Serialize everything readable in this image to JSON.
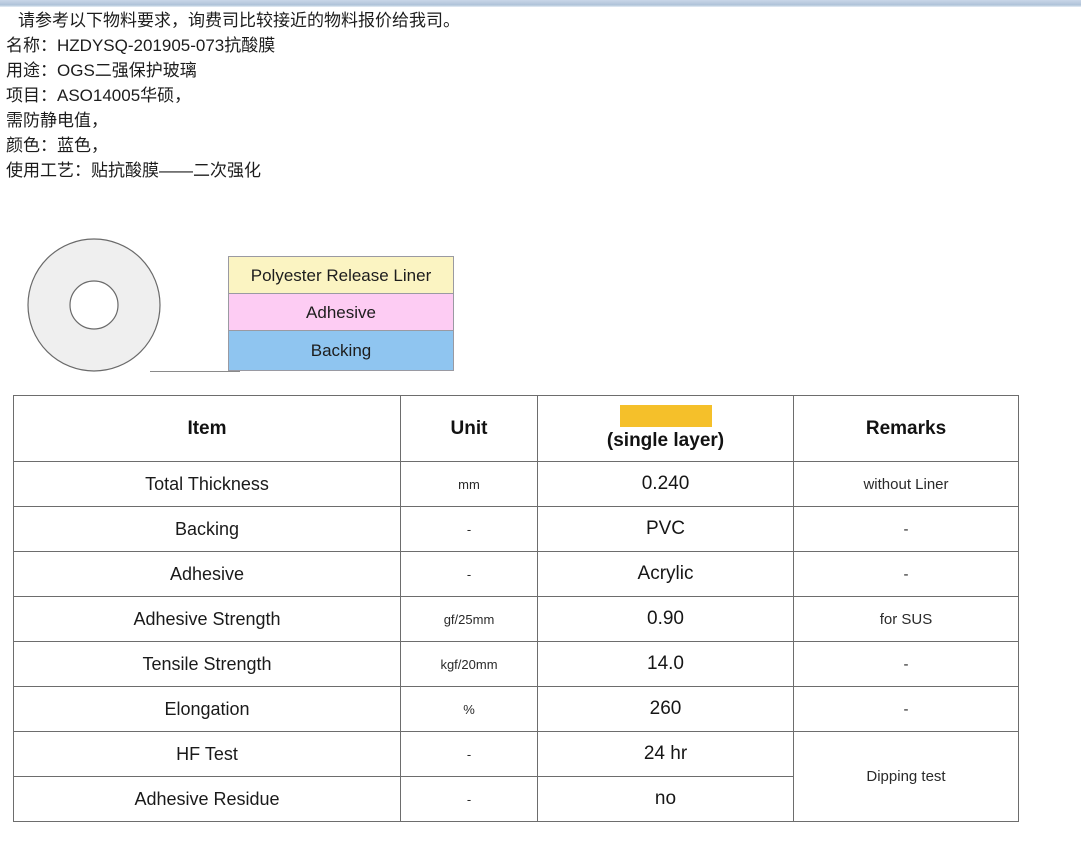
{
  "intro": {
    "lines": [
      {
        "text": "请参考以下物料要求，询费司比较接近的物料报价给我司。",
        "indent": true
      },
      {
        "text": "名称：HZDYSQ-201905-073抗酸膜",
        "indent": false
      },
      {
        "text": "用途：OGS二强保护玻璃",
        "indent": false
      },
      {
        "text": "项目：ASO14005华硕，",
        "indent": false
      },
      {
        "text": "需防静电值，",
        "indent": false
      },
      {
        "text": "颜色：蓝色，",
        "indent": false
      },
      {
        "text": "使用工艺：贴抗酸膜——二次强化",
        "indent": false
      }
    ]
  },
  "diagram": {
    "roll_label": "tape-roll",
    "layers": [
      {
        "name": "liner",
        "label": "Polyester Release Liner",
        "color": "#fbf4c2"
      },
      {
        "name": "adhesive",
        "label": "Adhesive",
        "color": "#fdccf3"
      },
      {
        "name": "backing",
        "label": "Backing",
        "color": "#8fc5f0"
      }
    ]
  },
  "table": {
    "headers": {
      "item": "Item",
      "unit": "Unit",
      "value_redacted": "",
      "value_sub": "(single layer)",
      "remarks": "Remarks"
    },
    "redaction_color": "#f5c02a",
    "rows": [
      {
        "item": "Total Thickness",
        "unit": "mm",
        "value": "0.240",
        "remark": "without Liner"
      },
      {
        "item": "Backing",
        "unit": "-",
        "value": "PVC",
        "remark": "-"
      },
      {
        "item": "Adhesive",
        "unit": "-",
        "value": "Acrylic",
        "remark": "-"
      },
      {
        "item": "Adhesive Strength",
        "unit": "gf/25mm",
        "value": "0.90",
        "remark": "for SUS"
      },
      {
        "item": "Tensile Strength",
        "unit": "kgf/20mm",
        "value": "14.0",
        "remark": "-"
      },
      {
        "item": "Elongation",
        "unit": "%",
        "value": "260",
        "remark": "-"
      },
      {
        "item": "HF Test",
        "unit": "-",
        "value": "24 hr",
        "remark": "Dipping test"
      },
      {
        "item": "Adhesive Residue",
        "unit": "-",
        "value": "no",
        "remark": ""
      }
    ]
  }
}
